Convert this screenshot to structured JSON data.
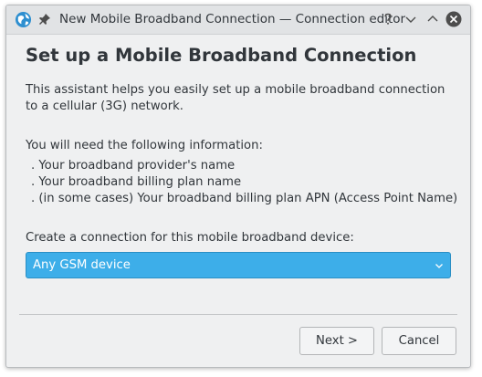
{
  "window": {
    "title": "New Mobile Broadband Connection — Connection editor",
    "icons": {
      "app": "kde-globe-icon",
      "pin": "pin-icon",
      "help": "help-icon",
      "minimize": "minimize-icon",
      "maximize": "maximize-icon",
      "close": "close-icon"
    }
  },
  "page": {
    "heading": "Set up a Mobile Broadband Connection",
    "intro": "This assistant helps you easily set up a mobile broadband connection to a cellular (3G) network.",
    "need_label": "You will need the following information:",
    "bullets": [
      " . Your broadband provider's name",
      " . Your broadband billing plan name",
      " . (in some cases) Your broadband billing plan APN (Access Point Name)"
    ],
    "device_label": "Create a connection for this mobile broadband device:",
    "device_selected": "Any GSM device"
  },
  "buttons": {
    "next": "Next >",
    "cancel": "Cancel"
  },
  "colors": {
    "accent": "#3daee9",
    "text": "#31363b",
    "window_bg": "#eff0f1",
    "titlebar_bg": "#e1e3e5"
  }
}
